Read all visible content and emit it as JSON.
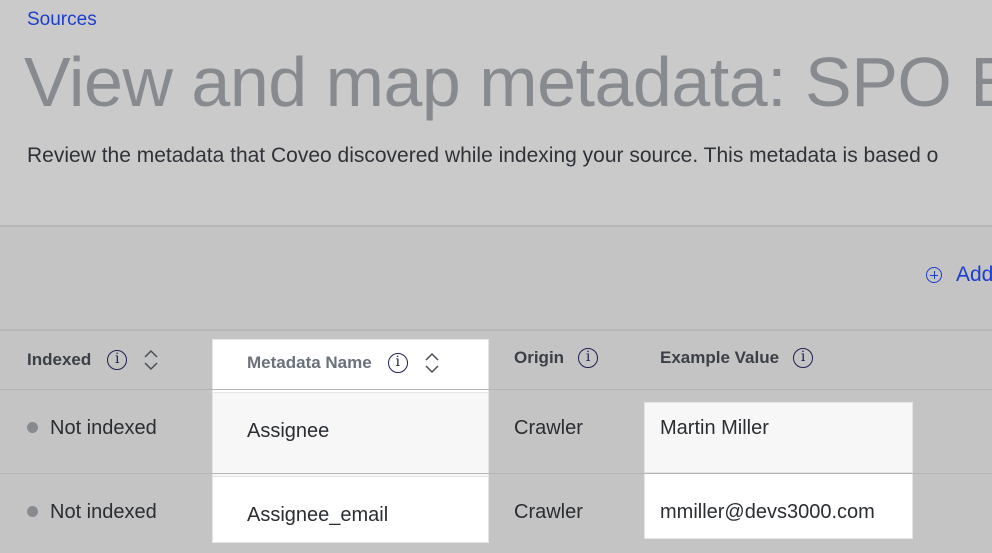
{
  "breadcrumb": {
    "label": "Sources"
  },
  "page": {
    "title": "View and map metadata: SPO Ex",
    "description": "Review the metadata that Coveo discovered while indexing your source. This metadata is based o"
  },
  "toolbar": {
    "add_label": "Add",
    "add_icon": "plus-circle-icon"
  },
  "table": {
    "columns": [
      {
        "label": "Indexed",
        "info_icon": "info-icon",
        "sortable": true
      },
      {
        "label": "Metadata Name",
        "info_icon": "info-icon",
        "sortable": true
      },
      {
        "label": "Origin",
        "info_icon": "info-icon",
        "sortable": false
      },
      {
        "label": "Example Value",
        "info_icon": "info-icon",
        "sortable": false
      }
    ],
    "rows": [
      {
        "indexed": "Not indexed",
        "name": "Assignee",
        "origin": "Crawler",
        "example": "Martin Miller"
      },
      {
        "indexed": "Not indexed",
        "name": "Assignee_email",
        "origin": "Crawler",
        "example": "mmiller@devs3000.com"
      }
    ]
  },
  "icons": {
    "info_glyph": "i"
  },
  "colors": {
    "link": "#1b3ecf",
    "title": "#878b90",
    "status_dot": "#878b90",
    "info_icon": "#1f2050"
  }
}
